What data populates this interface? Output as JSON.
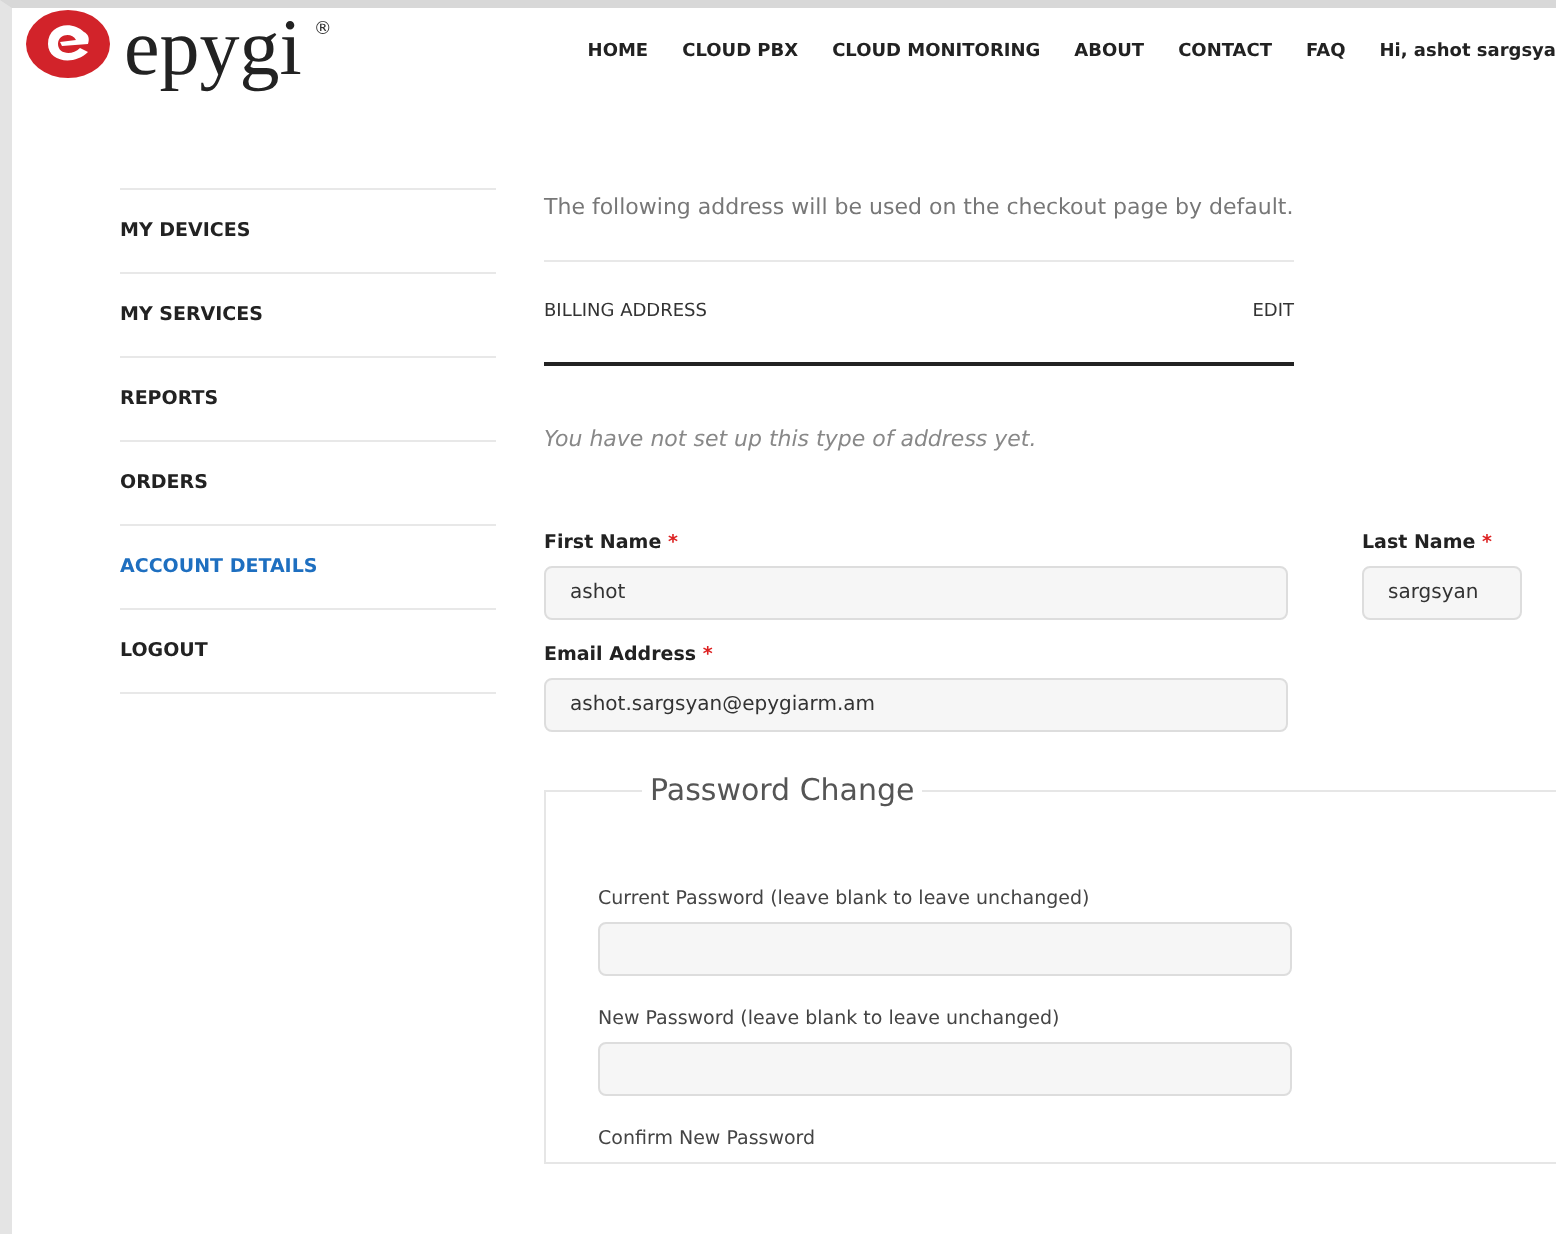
{
  "header": {
    "logo_text": "epygi",
    "logo_mark": "®",
    "nav": [
      "HOME",
      "CLOUD PBX",
      "CLOUD MONITORING",
      "ABOUT",
      "CONTACT",
      "FAQ"
    ],
    "greeting": "Hi, ashot sargsya"
  },
  "sidebar": {
    "items": [
      {
        "label": "MY DEVICES",
        "selected": false
      },
      {
        "label": "MY SERVICES",
        "selected": false
      },
      {
        "label": "REPORTS",
        "selected": false
      },
      {
        "label": "ORDERS",
        "selected": false
      },
      {
        "label": "ACCOUNT DETAILS",
        "selected": true
      },
      {
        "label": "LOGOUT",
        "selected": false
      }
    ]
  },
  "address": {
    "intro": "The following address will be used on the checkout page by default.",
    "title": "BILLING ADDRESS",
    "edit": "EDIT",
    "empty_note": "You have not set up this type of address yet."
  },
  "account": {
    "first_name": {
      "label": "First Name",
      "required": "*",
      "value": "ashot"
    },
    "last_name": {
      "label": "Last Name",
      "required": "*",
      "value": "sargsyan"
    },
    "email": {
      "label": "Email Address",
      "required": "*",
      "value": "ashot.sargsyan@epygiarm.am"
    }
  },
  "password": {
    "legend": "Password Change",
    "fields": [
      {
        "label": "Current Password (leave blank to leave unchanged)",
        "kind": "field"
      },
      {
        "label": "New Password (leave blank to leave unchanged)",
        "kind": "field"
      },
      {
        "label": "Confirm New Password",
        "kind": "label"
      }
    ]
  }
}
